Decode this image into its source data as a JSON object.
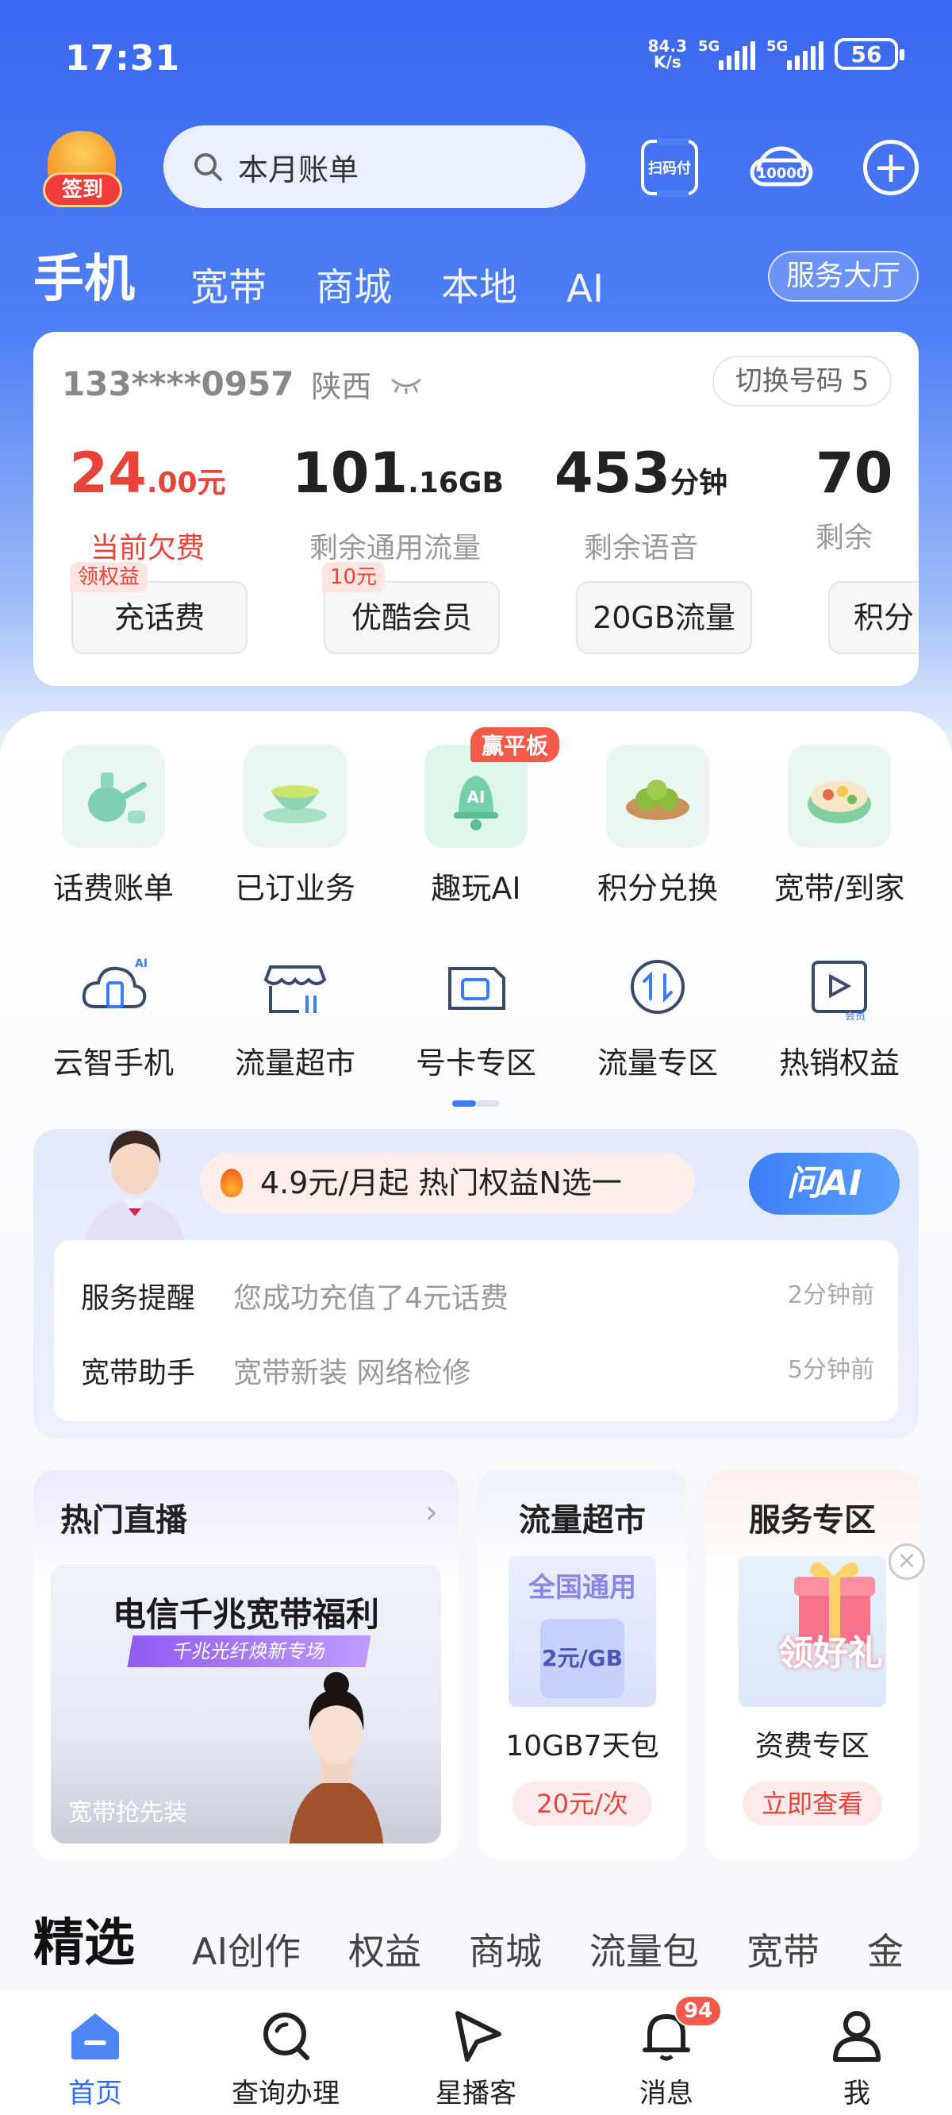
{
  "status_bar": {
    "time": "17:31",
    "net_speed": "84.3",
    "net_unit": "K/s",
    "sim1": "5G",
    "sim2": "5G",
    "battery": "56"
  },
  "header": {
    "signin_label": "签到",
    "search_placeholder": "本月账单",
    "scan_label": "扫码付",
    "hotline_label": "10000",
    "tabs": [
      "手机",
      "宽带",
      "商城",
      "本地",
      "AI"
    ],
    "service_hall": "服务大厅"
  },
  "account": {
    "phone": "133****0957",
    "province": "陕西",
    "switch_label": "切换号码 5",
    "metrics": [
      {
        "value": "24",
        "decimal": ".00",
        "unit": "元",
        "label": "当前欠费"
      },
      {
        "value": "101",
        "decimal": ".16",
        "unit": "GB",
        "label": "剩余通用流量"
      },
      {
        "value": "453",
        "decimal": "",
        "unit": "分钟",
        "label": "剩余语音"
      },
      {
        "value": "70",
        "decimal": "",
        "unit": "",
        "label": "剩余"
      }
    ],
    "chips": [
      {
        "label": "充话费",
        "badge": "领权益"
      },
      {
        "label": "优酷会员",
        "badge": "10元"
      },
      {
        "label": "20GB流量",
        "badge": ""
      },
      {
        "label": "积分",
        "badge": ""
      }
    ]
  },
  "grid_row1": [
    {
      "label": "话费账单",
      "icon": "teapot-icon"
    },
    {
      "label": "已订业务",
      "icon": "tea-cup-icon"
    },
    {
      "label": "趣玩AI",
      "icon": "ai-bell-icon",
      "hot": "赢平板"
    },
    {
      "label": "积分兑换",
      "icon": "dumplings-icon"
    },
    {
      "label": "宽带/到家",
      "icon": "bento-icon"
    }
  ],
  "grid_row2": [
    {
      "label": "云智手机",
      "icon": "cloud-phone-icon"
    },
    {
      "label": "流量超市",
      "icon": "store-icon"
    },
    {
      "label": "号卡专区",
      "icon": "sim-card-icon"
    },
    {
      "label": "流量专区",
      "icon": "data-transfer-icon"
    },
    {
      "label": "热销权益",
      "icon": "play-vip-icon"
    }
  ],
  "ai_card": {
    "promo": "4.9元/月起 热门权益N选一",
    "ask_ai": "问AI",
    "reminders": [
      {
        "key": "服务提醒",
        "desc": "您成功充值了4元话费",
        "time": "2分钟前"
      },
      {
        "key": "宽带助手",
        "desc": "宽带新装 网络检修",
        "time": "5分钟前"
      }
    ]
  },
  "live": {
    "title": "热门直播",
    "headline": "电信千兆宽带福利",
    "subline": "千兆光纤焕新专场",
    "caption": "宽带抢先装"
  },
  "traffic_market": {
    "title": "流量超市",
    "img_text": "全国通用",
    "price_tag": "2元/GB",
    "name": "10GB7天包",
    "button": "20元/次"
  },
  "service_zone": {
    "title": "服务专区",
    "gift_text": "领好礼",
    "name": "资费专区",
    "button": "立即查看"
  },
  "feed_tabs": [
    "精选",
    "AI创作",
    "权益",
    "商城",
    "流量包",
    "宽带",
    "金"
  ],
  "bottom_nav": [
    {
      "label": "首页",
      "icon": "home-icon"
    },
    {
      "label": "查询办理",
      "icon": "search-query-icon"
    },
    {
      "label": "星播客",
      "icon": "star-play-icon"
    },
    {
      "label": "消息",
      "icon": "bell-icon",
      "badge": "94"
    },
    {
      "label": "我",
      "icon": "profile-icon"
    }
  ],
  "colors": {
    "primary": "#3b67f2",
    "accent_red": "#e8443a",
    "nav_active": "#2f6cf6"
  }
}
